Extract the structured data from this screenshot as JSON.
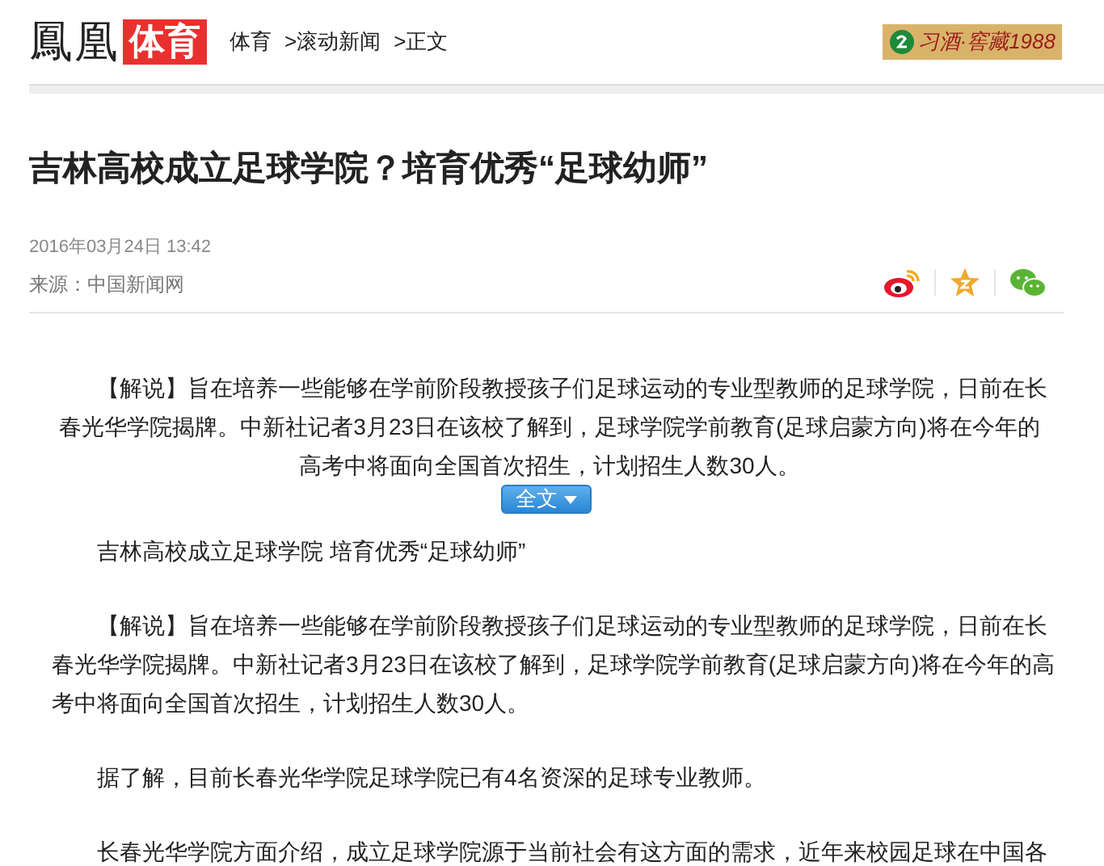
{
  "header": {
    "logo_text": "鳳凰",
    "logo_badge": "体育",
    "breadcrumb": [
      {
        "label": "体育"
      },
      {
        "label": ">滚动新闻"
      },
      {
        "label": ">正文"
      }
    ],
    "ad": {
      "text": "习酒·窖藏1988"
    }
  },
  "article": {
    "title": "吉林高校成立足球学院？培育优秀“足球幼师”",
    "date": "2016年03月24日  13:42",
    "source": "来源：中国新闻网",
    "summary": "【解说】旨在培养一些能够在学前阶段教授孩子们足球运动的专业型教师的足球学院，日前在长春光华学院揭牌。中新社记者3月23日在该校了解到，足球学院学前教育(足球启蒙方向)将在今年的高考中将面向全国首次招生，计划招生人数30人。",
    "expand_button": "全文",
    "paragraphs": [
      "吉林高校成立足球学院 培育优秀“足球幼师”",
      "【解说】旨在培养一些能够在学前阶段教授孩子们足球运动的专业型教师的足球学院，日前在长春光华学院揭牌。中新社记者3月23日在该校了解到，足球学院学前教育(足球启蒙方向)将在今年的高考中将面向全国首次招生，计划招生人数30人。",
      "据了解，目前长春光华学院足球学院已有4名资深的足球专业教师。",
      "长春光华学院方面介绍，成立足球学院源于当前社会有这方面的需求，近年来校园足球在中国各"
    ]
  }
}
